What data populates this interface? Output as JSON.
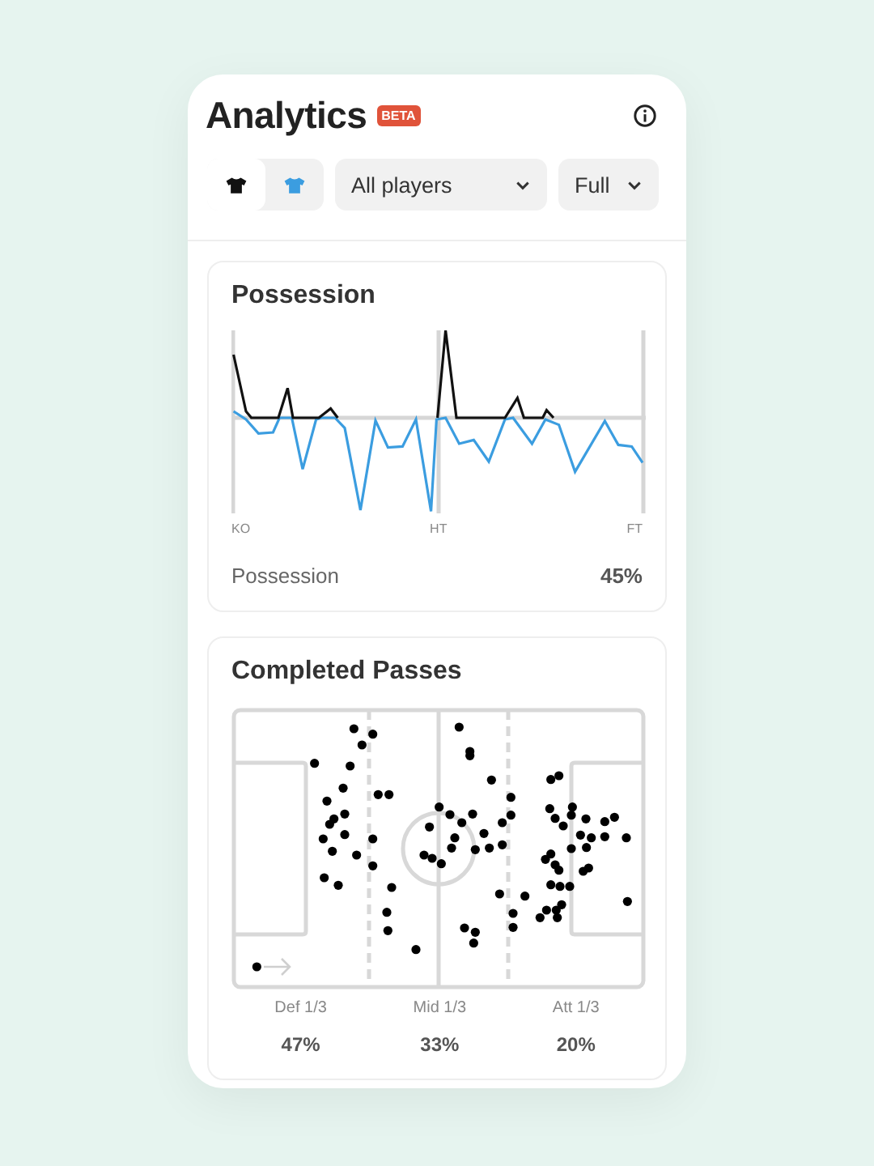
{
  "header": {
    "title": "Analytics",
    "badge": "BETA"
  },
  "teams": [
    {
      "selected": true,
      "color": "#111111"
    },
    {
      "selected": false,
      "color": "#3b9de0"
    }
  ],
  "filters": [
    {
      "value": "All players"
    },
    {
      "value": "Full"
    }
  ],
  "possession": {
    "title": "Possession",
    "axis_labels": [
      "KO",
      "HT",
      "FT"
    ],
    "label": "Possession",
    "value": "45%"
  },
  "passes": {
    "title": "Completed Passes",
    "zones": [
      {
        "label": "Def 1/3",
        "value": "47%"
      },
      {
        "label": "Mid 1/3",
        "value": "33%"
      },
      {
        "label": "Att 1/3",
        "value": "20%"
      }
    ]
  }
}
